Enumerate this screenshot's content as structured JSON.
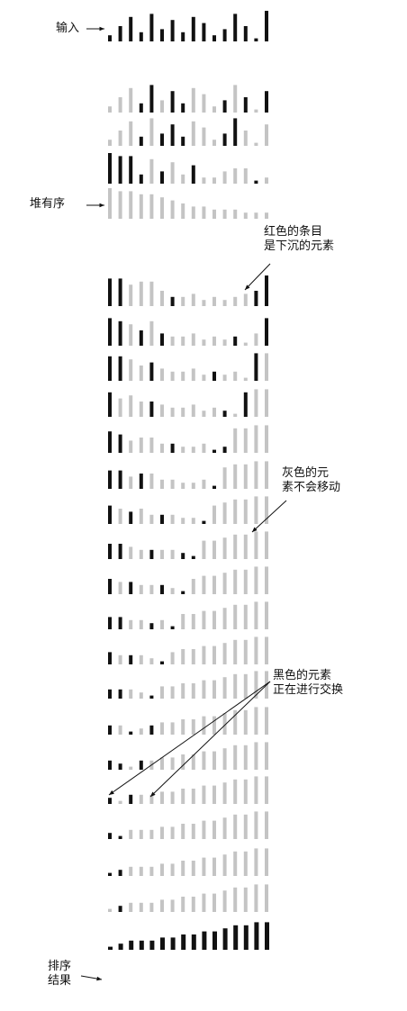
{
  "labels": {
    "input": "输入",
    "heap_ordered": "堆有序",
    "red_line1": "红色的条目",
    "red_line2": "是下沉的元素",
    "gray_line1": "灰色的元",
    "gray_line2": "素不会移动",
    "black_line1": "黑色的元素",
    "black_line2": "正在进行交换",
    "result_line1": "排序",
    "result_line2": "结果"
  },
  "colors": {
    "black": "#111111",
    "gray": "#c4c4c4"
  },
  "bar_values_input": [
    2,
    5,
    8,
    3,
    9,
    4,
    7,
    3,
    8,
    6,
    2,
    4,
    9,
    5,
    1,
    10
  ],
  "rows": [
    {
      "k": "input",
      "h": [
        2,
        5,
        8,
        3,
        9,
        4,
        7,
        3,
        8,
        6,
        2,
        4,
        9,
        5,
        1,
        10
      ],
      "c": "bbbbbbbbbbbbbbbb"
    },
    {
      "k": "build",
      "h": [
        2,
        5,
        8,
        3,
        9,
        4,
        7,
        3,
        8,
        6,
        2,
        4,
        9,
        5,
        1,
        7
      ],
      "c": "gggbbgbbgggbgbgb"
    },
    {
      "k": "build",
      "h": [
        2,
        5,
        8,
        3,
        9,
        4,
        7,
        3,
        8,
        6,
        2,
        4,
        9,
        5,
        1,
        7
      ],
      "c": "gggbgbbbgggbbggg"
    },
    {
      "k": "build",
      "h": [
        10,
        9,
        9,
        3,
        8,
        4,
        7,
        3,
        6,
        2,
        2,
        4,
        5,
        5,
        1,
        2
      ],
      "c": "bbbbgbggbgggggbg"
    },
    {
      "k": "heap",
      "h": [
        10,
        9,
        9,
        8,
        8,
        7,
        6,
        5,
        4,
        4,
        3,
        3,
        3,
        2,
        2,
        2
      ],
      "c": "gggggggggggggggg"
    },
    {
      "k": "sort",
      "h": [
        9,
        9,
        7,
        8,
        8,
        5,
        3,
        3,
        4,
        2,
        3,
        2,
        3,
        4,
        5,
        10
      ],
      "c": "bbggggbgggggggbb"
    },
    {
      "k": "sort",
      "h": [
        9,
        8,
        7,
        5,
        8,
        4,
        3,
        3,
        4,
        2,
        3,
        2,
        3,
        1,
        4,
        9
      ],
      "c": "bbgbgbggggggbggb"
    },
    {
      "k": "sort",
      "h": [
        8,
        8,
        7,
        5,
        6,
        4,
        3,
        3,
        4,
        2,
        3,
        2,
        3,
        1,
        9,
        9
      ],
      "c": "bbggbgggggbgggbg"
    },
    {
      "k": "sort",
      "h": [
        8,
        6,
        7,
        5,
        5,
        4,
        3,
        3,
        4,
        2,
        3,
        2,
        1,
        8,
        9,
        9
      ],
      "c": "bgggbggggggbgbgg"
    },
    {
      "k": "sort",
      "h": [
        7,
        6,
        4,
        5,
        5,
        3,
        3,
        2,
        2,
        3,
        1,
        2,
        8,
        8,
        9,
        9
      ],
      "c": "bbggggbgggbbgggg"
    },
    {
      "k": "sort",
      "h": [
        6,
        6,
        4,
        5,
        5,
        3,
        3,
        2,
        2,
        3,
        1,
        7,
        8,
        8,
        9,
        9
      ],
      "c": "bbgbggggggbggggg"
    },
    {
      "k": "sort",
      "h": [
        6,
        5,
        4,
        5,
        3,
        3,
        3,
        2,
        2,
        1,
        6,
        7,
        8,
        8,
        9,
        9
      ],
      "c": "bgbggbgggbgggggg"
    },
    {
      "k": "sort",
      "h": [
        5,
        5,
        4,
        3,
        3,
        3,
        3,
        2,
        1,
        6,
        6,
        7,
        8,
        8,
        9,
        9
      ],
      "c": "bbggbggbbggggggg"
    },
    {
      "k": "sort",
      "h": [
        5,
        4,
        4,
        3,
        3,
        3,
        2,
        1,
        5,
        6,
        6,
        7,
        8,
        8,
        9,
        9
      ],
      "c": "bgbggbgbgggggggg"
    },
    {
      "k": "sort",
      "h": [
        4,
        4,
        3,
        3,
        2,
        3,
        1,
        5,
        5,
        6,
        6,
        7,
        8,
        8,
        9,
        9
      ],
      "c": "bbggbgbggggggggg"
    },
    {
      "k": "sort",
      "h": [
        4,
        3,
        3,
        3,
        2,
        1,
        4,
        5,
        5,
        6,
        6,
        7,
        8,
        8,
        9,
        9
      ],
      "c": "bgbggbgggggggggg"
    },
    {
      "k": "sort",
      "h": [
        3,
        3,
        3,
        2,
        1,
        4,
        4,
        5,
        5,
        6,
        6,
        7,
        8,
        8,
        9,
        9
      ],
      "c": "bbggbggggggggggg"
    },
    {
      "k": "sort",
      "h": [
        3,
        3,
        1,
        2,
        3,
        4,
        4,
        5,
        5,
        6,
        6,
        7,
        8,
        8,
        9,
        9
      ],
      "c": "bgbgbggggggggggg"
    },
    {
      "k": "sort",
      "h": [
        3,
        2,
        1,
        3,
        3,
        4,
        4,
        5,
        5,
        6,
        6,
        7,
        8,
        8,
        9,
        9
      ],
      "c": "bbgbgggggggggggg"
    },
    {
      "k": "sort",
      "h": [
        2,
        1,
        3,
        3,
        3,
        4,
        4,
        5,
        5,
        6,
        6,
        7,
        8,
        8,
        9,
        9
      ],
      "c": "bgbggggggggggggg"
    },
    {
      "k": "sort",
      "h": [
        2,
        1,
        3,
        3,
        3,
        4,
        4,
        5,
        5,
        6,
        6,
        7,
        8,
        8,
        9,
        9
      ],
      "c": "bbgggggggggggggg"
    },
    {
      "k": "sort",
      "h": [
        1,
        2,
        3,
        3,
        3,
        4,
        4,
        5,
        5,
        6,
        6,
        7,
        8,
        8,
        9,
        9
      ],
      "c": "bbgggggggggggggg"
    },
    {
      "k": "sort",
      "h": [
        1,
        2,
        3,
        3,
        3,
        4,
        4,
        5,
        5,
        6,
        6,
        7,
        8,
        8,
        9,
        9
      ],
      "c": "gbgggggggggggggg"
    },
    {
      "k": "result",
      "h": [
        1,
        2,
        3,
        3,
        3,
        4,
        4,
        5,
        5,
        6,
        6,
        7,
        8,
        8,
        9,
        9
      ],
      "c": "bbbbbbbbbbbbbbbb"
    }
  ]
}
